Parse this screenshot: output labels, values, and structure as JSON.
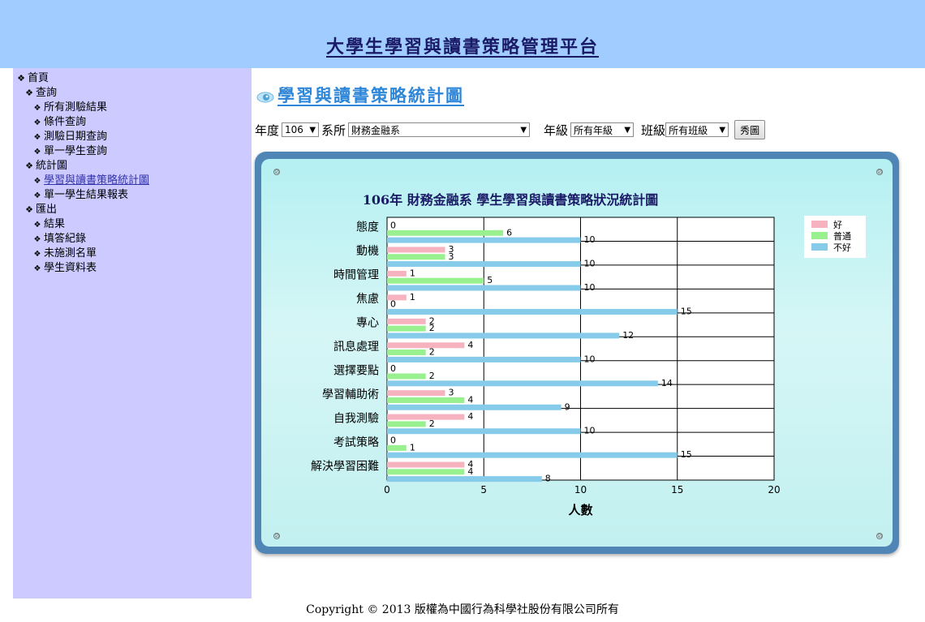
{
  "header": {
    "title": "大學生學習與讀書策略管理平台"
  },
  "sidebar": {
    "items": [
      {
        "level": 0,
        "label": "首頁",
        "link": false
      },
      {
        "level": 1,
        "label": "查詢",
        "link": false
      },
      {
        "level": 2,
        "label": "所有測驗結果",
        "link": false
      },
      {
        "level": 2,
        "label": "條件查詢",
        "link": false
      },
      {
        "level": 2,
        "label": "測驗日期查詢",
        "link": false
      },
      {
        "level": 2,
        "label": "單一學生查詢",
        "link": false
      },
      {
        "level": 1,
        "label": "統計圖",
        "link": false
      },
      {
        "level": 2,
        "label": "學習與讀書策略統計圖",
        "link": true
      },
      {
        "level": 2,
        "label": "單一學生結果報表",
        "link": false
      },
      {
        "level": 1,
        "label": "匯出",
        "link": false
      },
      {
        "level": 2,
        "label": "結果",
        "link": false
      },
      {
        "level": 2,
        "label": "填答紀錄",
        "link": false
      },
      {
        "level": 2,
        "label": "未施測名單",
        "link": false
      },
      {
        "level": 2,
        "label": "學生資料表",
        "link": false
      }
    ]
  },
  "main": {
    "title": "學習與讀書策略統計圖"
  },
  "filters": {
    "year_label": "年度",
    "year_value": "106",
    "dept_label": "系所",
    "dept_value": "財務金融系",
    "grade_label": "年級",
    "grade_value": "所有年級",
    "class_label": "班級",
    "class_value": "所有班級",
    "show_button": "秀圖"
  },
  "colors": {
    "good": "#f6b3bf",
    "normal": "#99f08f",
    "bad": "#87cbea",
    "header_bg": "#a0ccff",
    "sidebar_bg": "#cccaff"
  },
  "chart_data": {
    "type": "bar",
    "orientation": "horizontal",
    "title": "106年  財務金融系  學生學習與讀書策略狀況統計圖",
    "xlabel": "人數",
    "ylabel": "",
    "xlim": [
      0,
      20
    ],
    "xticks": [
      0,
      5,
      10,
      15,
      20
    ],
    "grid": true,
    "legend_position": "top-right",
    "categories": [
      "態度",
      "動機",
      "時間管理",
      "焦慮",
      "專心",
      "訊息處理",
      "選擇要點",
      "學習輔助術",
      "自我測驗",
      "考試策略",
      "解決學習困難"
    ],
    "series": [
      {
        "name": "好",
        "color": "#f6b3bf",
        "values": [
          0,
          3,
          1,
          1,
          2,
          4,
          0,
          3,
          4,
          0,
          4
        ]
      },
      {
        "name": "普通",
        "color": "#99f08f",
        "values": [
          6,
          3,
          5,
          0,
          2,
          2,
          2,
          4,
          2,
          1,
          4
        ]
      },
      {
        "name": "不好",
        "color": "#87cbea",
        "values": [
          10,
          10,
          10,
          15,
          12,
          10,
          14,
          9,
          10,
          15,
          8
        ]
      }
    ]
  },
  "footer": {
    "text": "Copyright © 2013 版權為中國行為科學社股份有限公司所有"
  }
}
